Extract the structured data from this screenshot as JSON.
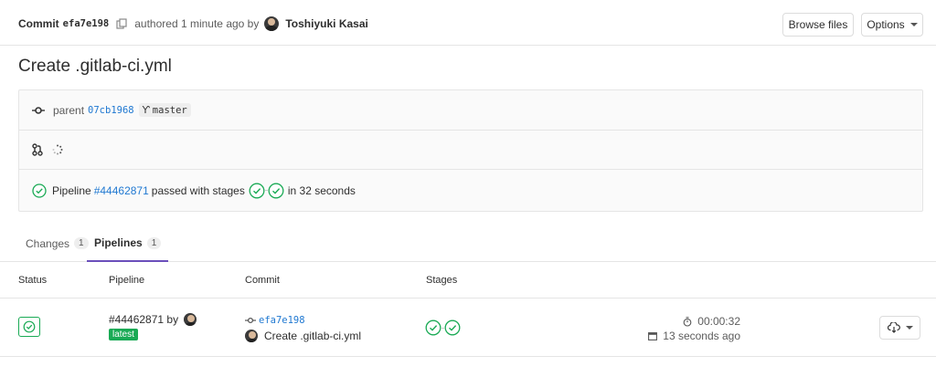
{
  "commit_header": {
    "commit_label": "Commit",
    "sha": "efa7e198",
    "authored_text": "authored 1 minute ago by",
    "author_name": "Toshiyuki Kasai",
    "browse_files_label": "Browse files",
    "options_label": "Options"
  },
  "commit_title": "Create .gitlab-ci.yml",
  "info": {
    "parent_label": "parent",
    "parent_sha": "07cb1968",
    "branch": "master",
    "pipeline_prefix": "Pipeline",
    "pipeline_id": "#44462871",
    "pipeline_middle": "passed with stages",
    "pipeline_suffix": "in 32 seconds"
  },
  "tabs": [
    {
      "label": "Changes",
      "count": "1"
    },
    {
      "label": "Pipelines",
      "count": "1"
    }
  ],
  "table": {
    "headers": [
      "Status",
      "Pipeline",
      "Commit",
      "Stages"
    ],
    "row": {
      "pipeline_id": "#44462871",
      "by": "by",
      "badge": "latest",
      "commit_sha": "efa7e198",
      "commit_message": "Create .gitlab-ci.yml",
      "duration": "00:00:32",
      "finished": "13 seconds ago"
    }
  },
  "colors": {
    "success": "#1aaa55",
    "link": "#1f78d1",
    "active_tab": "#6b4fbb"
  },
  "icons": [
    "copy-icon",
    "commit-icon",
    "branch-icon",
    "merge-request-icon",
    "spinner-icon",
    "status-success-icon",
    "timer-icon",
    "calendar-icon",
    "download-icon"
  ]
}
